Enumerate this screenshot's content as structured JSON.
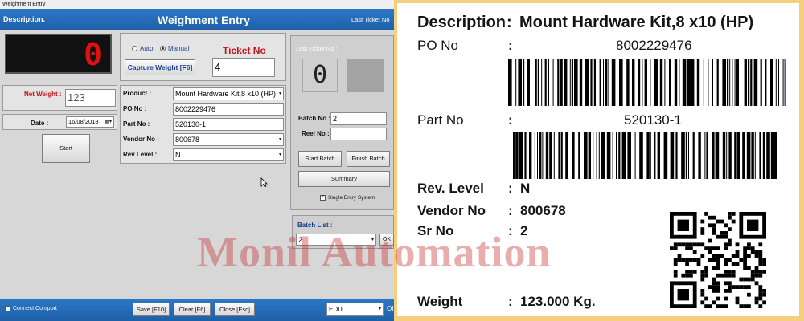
{
  "app": {
    "window_title": "Weighment Entry",
    "description_label": "Description.",
    "header_title": "Weighment Entry",
    "header_last_ticket": "Last Ticket No :",
    "display_value": "0",
    "mode": {
      "auto": "Auto",
      "manual": "Manual",
      "selected": "Manual"
    },
    "capture_button": "Capture Weight [F6]",
    "ticket_label": "Ticket No",
    "ticket_value": "4",
    "net_weight_label": "Net Weight :",
    "net_weight_value": "123",
    "date_label": "Date :",
    "date_value": "16/08/2018",
    "start_button": "Start",
    "product_label": "Product :",
    "product_value": "Mount Hardware Kit,8 x10  (HP)",
    "po_label": "PO No :",
    "po_value": "8002229476",
    "part_label": "Part No :",
    "part_value": "520130-1",
    "vendor_label": "Vendor No :",
    "vendor_value": "800678",
    "rev_label": "Rev Level :",
    "rev_value": "N",
    "last_ticket_panel_label": "Last Ticket No :",
    "last_ticket_value": "0",
    "batch_label": "Batch No :",
    "batch_value": "2",
    "reel_label": "Reel No :",
    "reel_value": "",
    "start_batch_button": "Start Batch",
    "finish_batch_button": "Finish Batch",
    "summary_button": "Summary",
    "single_entry_label": "Single Entry System",
    "single_entry_checked": true,
    "batch_list_label": "Batch List :",
    "batch_list_value": "2",
    "ok_button": "OK",
    "connect_comport_label": "Connect Comport",
    "save_button": "Save [F10]",
    "clear_button": "Clear [F6]",
    "close_button": "Close [Esc]",
    "mode_select_value": "EDIT",
    "trailing_text": "OI"
  },
  "watermark": "Monil Automation",
  "label": {
    "description_key": "Description",
    "description_value": "Mount Hardware Kit,8 x10  (HP)",
    "po_key": "PO No",
    "po_value": "8002229476",
    "part_key": "Part No",
    "part_value": "520130-1",
    "rev_key": "Rev. Level",
    "rev_value": "N",
    "vendor_key": "Vendor No",
    "vendor_value": "800678",
    "sr_key": "Sr No",
    "sr_value": "2",
    "weight_key": "Weight",
    "weight_value": "123.000 Kg.",
    "colon": ":"
  },
  "colors": {
    "header_blue": "#1f5fa8",
    "display_red": "#e01010",
    "ticket_red": "#c0141c",
    "label_border": "#f6cf7c"
  },
  "icons": [
    "calendar-icon",
    "dropdown-arrow-icon",
    "cursor-icon",
    "barcode-icon",
    "qr-code-icon"
  ]
}
